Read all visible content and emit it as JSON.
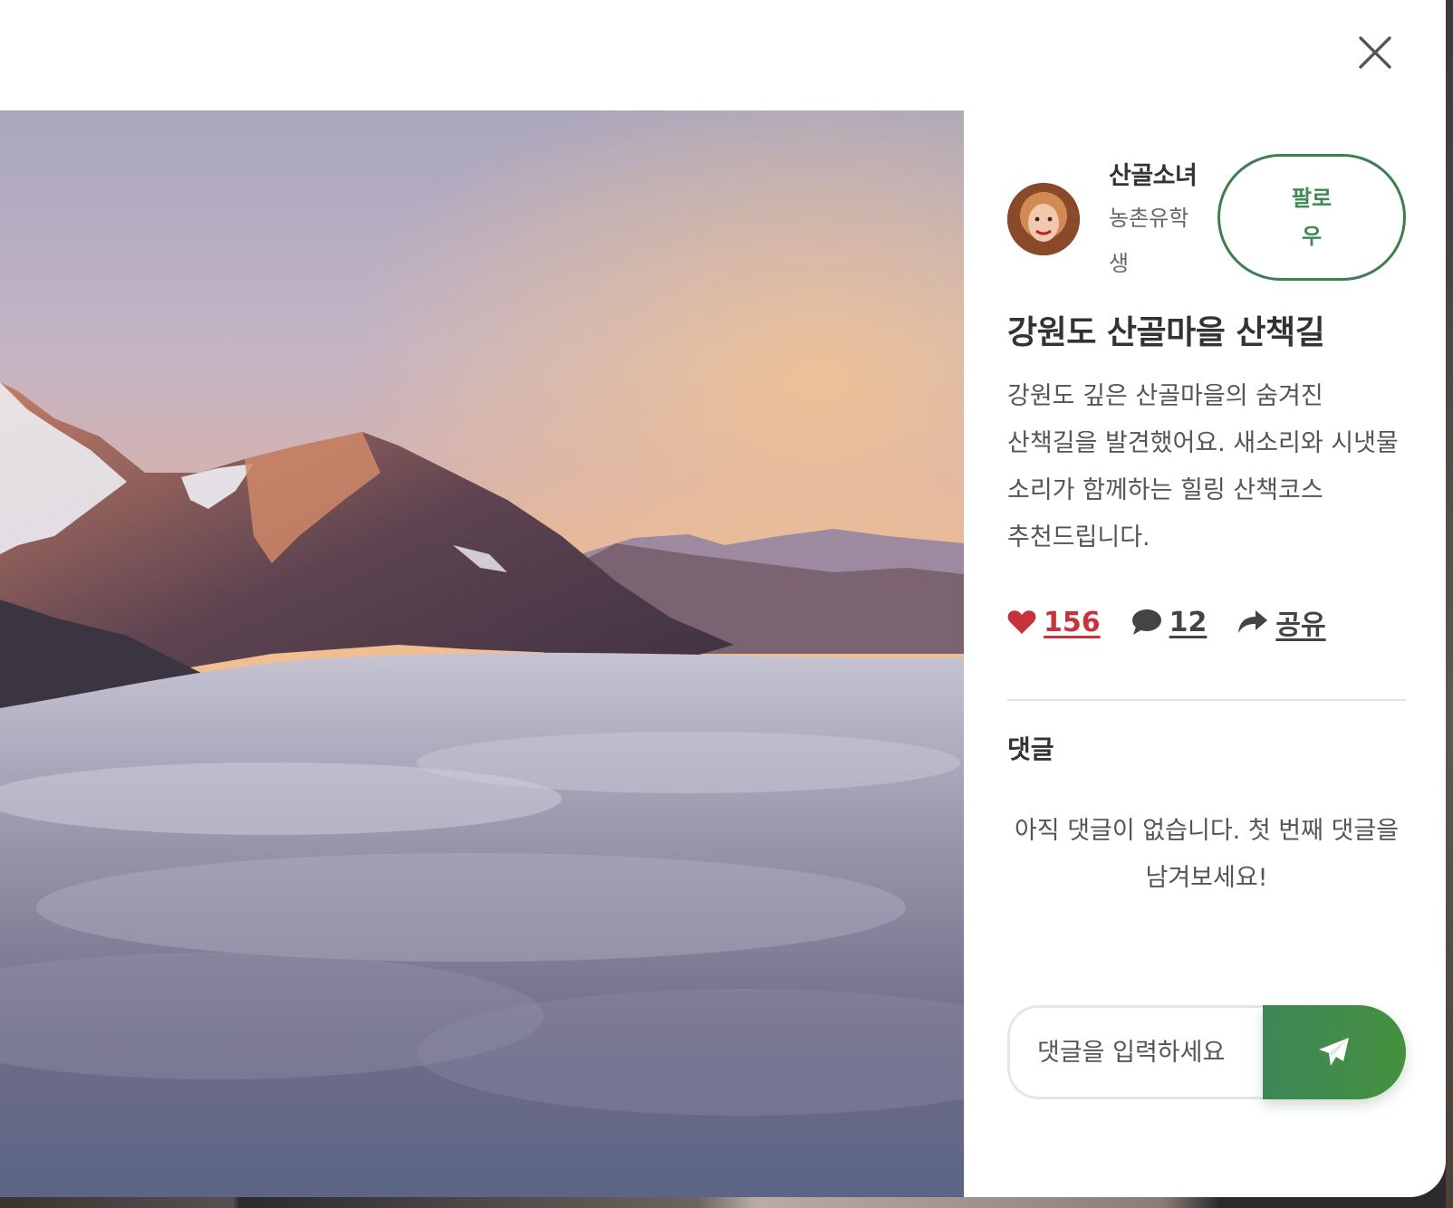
{
  "modal": {
    "close_label": "×",
    "photo_alt": "산 위로 펼쳐진 구름바다"
  },
  "author": {
    "name": "산골소녀",
    "subtitle": "농촌유학생",
    "follow_label": "팔로우"
  },
  "post": {
    "title": "강원도 산골마을 산책길",
    "description": "강원도 깊은 산골마을의 숨겨진 산책길을 발견했어요. 새소리와 시냇물 소리가 함께하는 힐링 산책코스 추천드립니다."
  },
  "actions": {
    "likes": "156",
    "comments": "12",
    "share_label": "공유"
  },
  "comments": {
    "heading": "댓글",
    "empty_message": "아직 댓글이 없습니다. 첫 번째 댓글을 남겨보세요!",
    "input_placeholder": "댓글을 입력하세요"
  },
  "colors": {
    "accent_green": "#3f8a52",
    "like_red": "#c8323c"
  },
  "icons": {
    "close": "close-icon",
    "like": "heart-icon",
    "comment": "speech-bubble-icon",
    "share": "share-arrow-icon",
    "send": "paper-plane-icon"
  }
}
